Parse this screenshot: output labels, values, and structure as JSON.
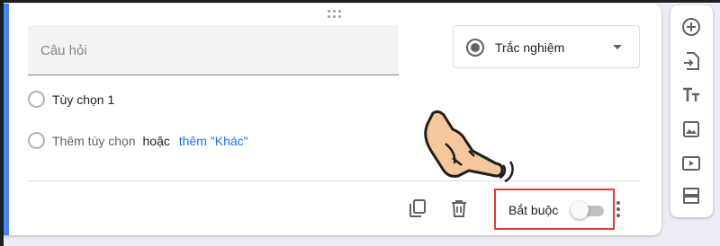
{
  "question": {
    "placeholder": "Câu hỏi",
    "type_label": "Trắc nghiệm"
  },
  "options": {
    "option1": "Tùy chọn 1",
    "add_option": "Thêm tùy chọn",
    "or": "hoặc",
    "add_other": "thêm \"Khác\""
  },
  "footer": {
    "required_label": "Bắt buộc",
    "required_on": false
  },
  "icons": {
    "copy": "copy-icon",
    "delete": "trash-icon",
    "more": "more-vert-icon",
    "add_question": "add-circle-icon",
    "import": "import-icon",
    "title": "title-text-icon",
    "image": "image-icon",
    "video": "video-icon",
    "section": "section-icon"
  },
  "colors": {
    "accent": "#4285f4",
    "link": "#1a73e8",
    "highlight_border": "#e53935"
  }
}
